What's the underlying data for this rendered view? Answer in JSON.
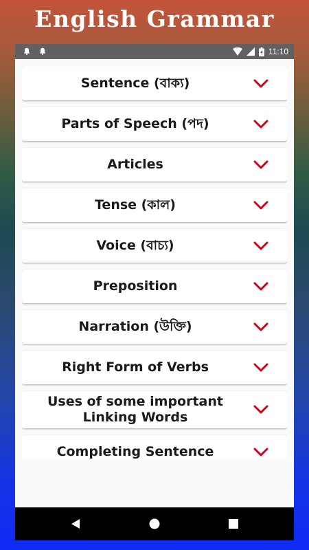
{
  "promo": {
    "title": "English Grammar"
  },
  "status_bar": {
    "time": "11:10",
    "icons": [
      "notification-bell-icon",
      "notification-bell-icon",
      "wifi-icon",
      "signal-icon",
      "battery-charging-icon"
    ]
  },
  "topics": [
    {
      "label": "Sentence (বাক্য)"
    },
    {
      "label": "Parts of Speech (পদ)"
    },
    {
      "label": "Articles"
    },
    {
      "label": "Tense (কাল)"
    },
    {
      "label": "Voice (বাচ্য)"
    },
    {
      "label": "Preposition"
    },
    {
      "label": "Narration (উক্তি)"
    },
    {
      "label": "Right Form of Verbs"
    },
    {
      "label": "Uses of some important Linking Words"
    },
    {
      "label": "Completing Sentence"
    }
  ],
  "colors": {
    "accent": "#d0021b",
    "card": "#ffffff",
    "status_bar": "#616161"
  },
  "nav_bar": {
    "icons": [
      "back-icon",
      "home-icon",
      "recents-icon"
    ]
  }
}
